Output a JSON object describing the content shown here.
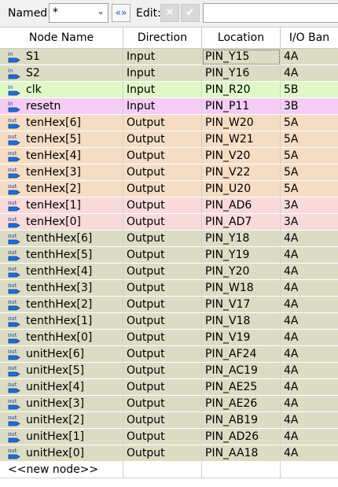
{
  "toolbar": {
    "named_label": "Named:",
    "named_value": "*",
    "edit_label": "Edit:",
    "edit_value": ""
  },
  "columns": [
    "Node Name",
    "Direction",
    "Location",
    "I/O Ban"
  ],
  "colors": {
    "input_bg": "#dcdcc4",
    "clk_bg": "#e0f8c8",
    "resetn_bg": "#f4ccf4",
    "bank5_bg": "#f5dcc4",
    "bank3_bg": "#f9dada",
    "bank4_bg": "#dcdcc4",
    "icon_in": "#1f6ed4",
    "icon_out": "#1f6ed4"
  },
  "rows": [
    {
      "icon": "in",
      "name": "S1",
      "direction": "Input",
      "location": "PIN_Y15",
      "bank": "4A",
      "bg": "#dcdcc4"
    },
    {
      "icon": "in",
      "name": "S2",
      "direction": "Input",
      "location": "PIN_Y16",
      "bank": "4A",
      "bg": "#dcdcc4"
    },
    {
      "icon": "in",
      "name": "clk",
      "direction": "Input",
      "location": "PIN_R20",
      "bank": "5B",
      "bg": "#e0f8c8"
    },
    {
      "icon": "in",
      "name": "resetn",
      "direction": "Input",
      "location": "PIN_P11",
      "bank": "3B",
      "bg": "#f4ccf4"
    },
    {
      "icon": "out",
      "name": "tenHex[6]",
      "direction": "Output",
      "location": "PIN_W20",
      "bank": "5A",
      "bg": "#f5dcc4"
    },
    {
      "icon": "out",
      "name": "tenHex[5]",
      "direction": "Output",
      "location": "PIN_W21",
      "bank": "5A",
      "bg": "#f5dcc4"
    },
    {
      "icon": "out",
      "name": "tenHex[4]",
      "direction": "Output",
      "location": "PIN_V20",
      "bank": "5A",
      "bg": "#f5dcc4"
    },
    {
      "icon": "out",
      "name": "tenHex[3]",
      "direction": "Output",
      "location": "PIN_V22",
      "bank": "5A",
      "bg": "#f5dcc4"
    },
    {
      "icon": "out",
      "name": "tenHex[2]",
      "direction": "Output",
      "location": "PIN_U20",
      "bank": "5A",
      "bg": "#f5dcc4"
    },
    {
      "icon": "out",
      "name": "tenHex[1]",
      "direction": "Output",
      "location": "PIN_AD6",
      "bank": "3A",
      "bg": "#f9dada"
    },
    {
      "icon": "out",
      "name": "tenHex[0]",
      "direction": "Output",
      "location": "PIN_AD7",
      "bank": "3A",
      "bg": "#f9dada"
    },
    {
      "icon": "out",
      "name": "tenthHex[6]",
      "direction": "Output",
      "location": "PIN_Y18",
      "bank": "4A",
      "bg": "#dcdcc4"
    },
    {
      "icon": "out",
      "name": "tenthHex[5]",
      "direction": "Output",
      "location": "PIN_Y19",
      "bank": "4A",
      "bg": "#dcdcc4"
    },
    {
      "icon": "out",
      "name": "tenthHex[4]",
      "direction": "Output",
      "location": "PIN_Y20",
      "bank": "4A",
      "bg": "#dcdcc4"
    },
    {
      "icon": "out",
      "name": "tenthHex[3]",
      "direction": "Output",
      "location": "PIN_W18",
      "bank": "4A",
      "bg": "#dcdcc4"
    },
    {
      "icon": "out",
      "name": "tenthHex[2]",
      "direction": "Output",
      "location": "PIN_V17",
      "bank": "4A",
      "bg": "#dcdcc4"
    },
    {
      "icon": "out",
      "name": "tenthHex[1]",
      "direction": "Output",
      "location": "PIN_V18",
      "bank": "4A",
      "bg": "#dcdcc4"
    },
    {
      "icon": "out",
      "name": "tenthHex[0]",
      "direction": "Output",
      "location": "PIN_V19",
      "bank": "4A",
      "bg": "#dcdcc4"
    },
    {
      "icon": "out",
      "name": "unitHex[6]",
      "direction": "Output",
      "location": "PIN_AF24",
      "bank": "4A",
      "bg": "#dcdcc4"
    },
    {
      "icon": "out",
      "name": "unitHex[5]",
      "direction": "Output",
      "location": "PIN_AC19",
      "bank": "4A",
      "bg": "#dcdcc4"
    },
    {
      "icon": "out",
      "name": "unitHex[4]",
      "direction": "Output",
      "location": "PIN_AE25",
      "bank": "4A",
      "bg": "#dcdcc4"
    },
    {
      "icon": "out",
      "name": "unitHex[3]",
      "direction": "Output",
      "location": "PIN_AE26",
      "bank": "4A",
      "bg": "#dcdcc4"
    },
    {
      "icon": "out",
      "name": "unitHex[2]",
      "direction": "Output",
      "location": "PIN_AB19",
      "bank": "4A",
      "bg": "#dcdcc4"
    },
    {
      "icon": "out",
      "name": "unitHex[1]",
      "direction": "Output",
      "location": "PIN_AD26",
      "bank": "4A",
      "bg": "#dcdcc4"
    },
    {
      "icon": "out",
      "name": "unitHex[0]",
      "direction": "Output",
      "location": "PIN_AA18",
      "bank": "4A",
      "bg": "#dcdcc4"
    }
  ],
  "new_node_label": "<<new node>>"
}
